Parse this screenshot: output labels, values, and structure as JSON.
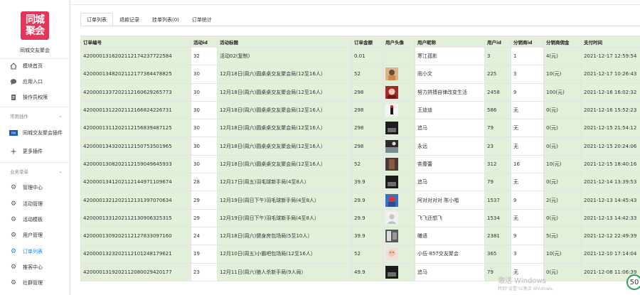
{
  "app": {
    "brand_name": "同城交友聚会",
    "logo_line1": "同城",
    "logo_line2": "聚会"
  },
  "sidebar": {
    "top_items": [
      {
        "label": "模块首页",
        "icon": "home-icon"
      },
      {
        "label": "应用入口",
        "icon": "chat-icon"
      },
      {
        "label": "操作员权限",
        "icon": "doc-icon"
      }
    ],
    "plugin_section_title": "常用插件",
    "plugin_items": [
      {
        "label": "同城交友聚会插件",
        "icon": "plugin-logo-icon"
      },
      {
        "label": "更多插件",
        "icon": "plus-icon"
      }
    ],
    "business_section_title": "业务菜单",
    "business_items": [
      {
        "label": "管理中心",
        "icon": "gear-icon"
      },
      {
        "label": "活动管理",
        "icon": "gear-icon"
      },
      {
        "label": "活动模板",
        "icon": "gear-icon"
      },
      {
        "label": "用户管理",
        "icon": "gear-icon"
      },
      {
        "label": "订单列表",
        "icon": "gear-icon",
        "active": true
      },
      {
        "label": "推客中心",
        "icon": "gear-icon"
      },
      {
        "label": "社群管理",
        "icon": "gear-icon"
      }
    ]
  },
  "tabs": [
    {
      "label": "订单列表",
      "active": true
    },
    {
      "label": "退款记录"
    },
    {
      "label": "挂单列表(0)"
    },
    {
      "label": "订单统计"
    }
  ],
  "table": {
    "headers": [
      "订单编号",
      "活动id",
      "活动标题",
      "订单金额",
      "用户头像",
      "用户昵称",
      "用户id",
      "分销商id",
      "分销商佣金",
      "支付时间"
    ],
    "rows": [
      [
        "4200001316202112174237722584",
        "32",
        "活动02(复制)",
        "0.01",
        "avatar-none",
        "寒江孤影",
        "3",
        "1",
        "4(元)",
        "2021-12-17 12:59:54"
      ],
      [
        "4200001348202112177364478825",
        "30",
        "12月18日(周六)圆桌桌交友聚会局(12至16人）",
        "52",
        "avatar-photo-1",
        "雨小文",
        "225",
        "3",
        "10(元)",
        "2021-12-17 10:26:43"
      ],
      [
        "4200001337202112160629265773",
        "30",
        "12月18日(周六)圆桌桌交友聚会局(12至16人）",
        "298",
        "avatar-photo-2",
        "努力拼搏自律改变生活",
        "2458",
        "9",
        "100(元)",
        "2021-12-16 16:02:32"
      ],
      [
        "4200001312202112166824226731",
        "30",
        "12月18日(周六)圆桌桌交友聚会局(12至16人）",
        "298",
        "avatar-photo-3",
        "王迪迪",
        "586",
        "无",
        "0(元)",
        "2021-12-16 15:52:23"
      ],
      [
        "4200001311202112156839487125",
        "30",
        "12月18日(周六)圆桌桌交友聚会局(12至16人）",
        "298",
        "avatar-photo-4",
        "追马",
        "79",
        "无",
        "0(元)",
        "2021-12-15 21:54:12"
      ],
      [
        "4200001343202112150753501965",
        "30",
        "12月18日(周六)圆桌桌交友聚会局(12至16人）",
        "298",
        "avatar-photo-5",
        "永远",
        "23",
        "无",
        "0(元)",
        "2021-12-15 20:24:06"
      ],
      [
        "4200001308202112159049645933",
        "30",
        "12月18日(周六)圆桌桌交友聚会局(12至16人）",
        "52",
        "avatar-photo-6",
        "茶蘼蕾",
        "312",
        "16",
        "10(元)",
        "2021-12-15 18:40:16"
      ],
      [
        "4200001341202112144971109674",
        "28",
        "12月17日(周五)羽毛球新手局(4至8人）",
        "39.9",
        "avatar-photo-4",
        "追马",
        "79",
        "无",
        "0(元)",
        "2021-12-14 13:39:53"
      ],
      [
        "4200001321202112131397070634",
        "29",
        "12月19日(周日下午)羽毛球新手局(4至8人）",
        "29.9",
        "avatar-photo-7",
        "阿对对对对 陈小唱",
        "1537",
        "9",
        "2(元)",
        "2021-12-13 14:45:43"
      ],
      [
        "4200001331202112130906325315",
        "29",
        "12月19日(周日下午)羽毛球新手局(4至8人）",
        "29.9",
        "avatar-default",
        "飞飞还想飞",
        "1534",
        "无",
        "0(元)",
        "2021-12-13 14:42:33"
      ],
      [
        "4200001309202112127833097160",
        "24",
        "12月18日(周六)健身房包场局(5至10人）",
        "39.9",
        "avatar-photo-8",
        "曦语",
        "2381",
        "9",
        "5(元)",
        "2021-12-12 22:49:39"
      ],
      [
        "4200001323202112101248179621",
        "19",
        "12月10日(周五)小霸吧包场局(12至16人）",
        "52",
        "avatar-photo-9",
        "小伍-857交友聚会",
        "365",
        "3",
        "10(元)",
        "2021-12-10 17:14:04"
      ],
      [
        "4200001319202112080029420177",
        "23",
        "12月11日(周六)狼人杀新手局(9人局）",
        "49.9",
        "avatar-photo-4",
        "追马",
        "79",
        "无",
        "0(元)",
        "2021-12-08 11:06:39"
      ]
    ]
  },
  "watermark": {
    "line1": "激活 Windows",
    "line2": "转到\"设置\"以激活 Windows。"
  },
  "badge_value": "50",
  "colors": {
    "brand": "#e5355a",
    "accent": "#1e88e5",
    "table_highlight": "#e2efd9"
  }
}
